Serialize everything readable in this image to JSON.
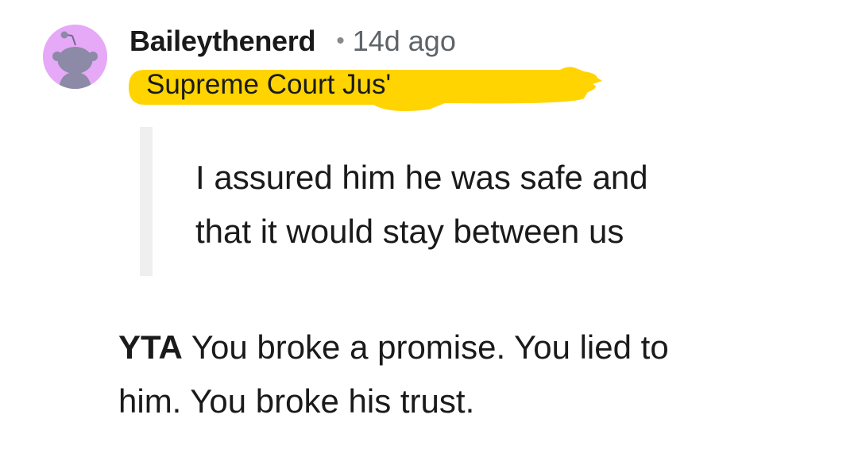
{
  "comment": {
    "author": "Baileythenerd",
    "separator": "•",
    "timestamp": "14d ago",
    "flair": "Supreme Court Jus'",
    "avatar_icon": "snoo-avatar-icon",
    "colors": {
      "avatar_bg": "#e6a9f7",
      "flair_bg": "#ffd400",
      "quote_bar": "#efefef"
    },
    "quote": {
      "line1": "I assured him he was safe and",
      "line2": "that it would stay between us"
    },
    "body": {
      "verdict": "YTA",
      "line1_rest": " You broke a promise. You lied to",
      "line2": "him. You broke his trust."
    }
  }
}
